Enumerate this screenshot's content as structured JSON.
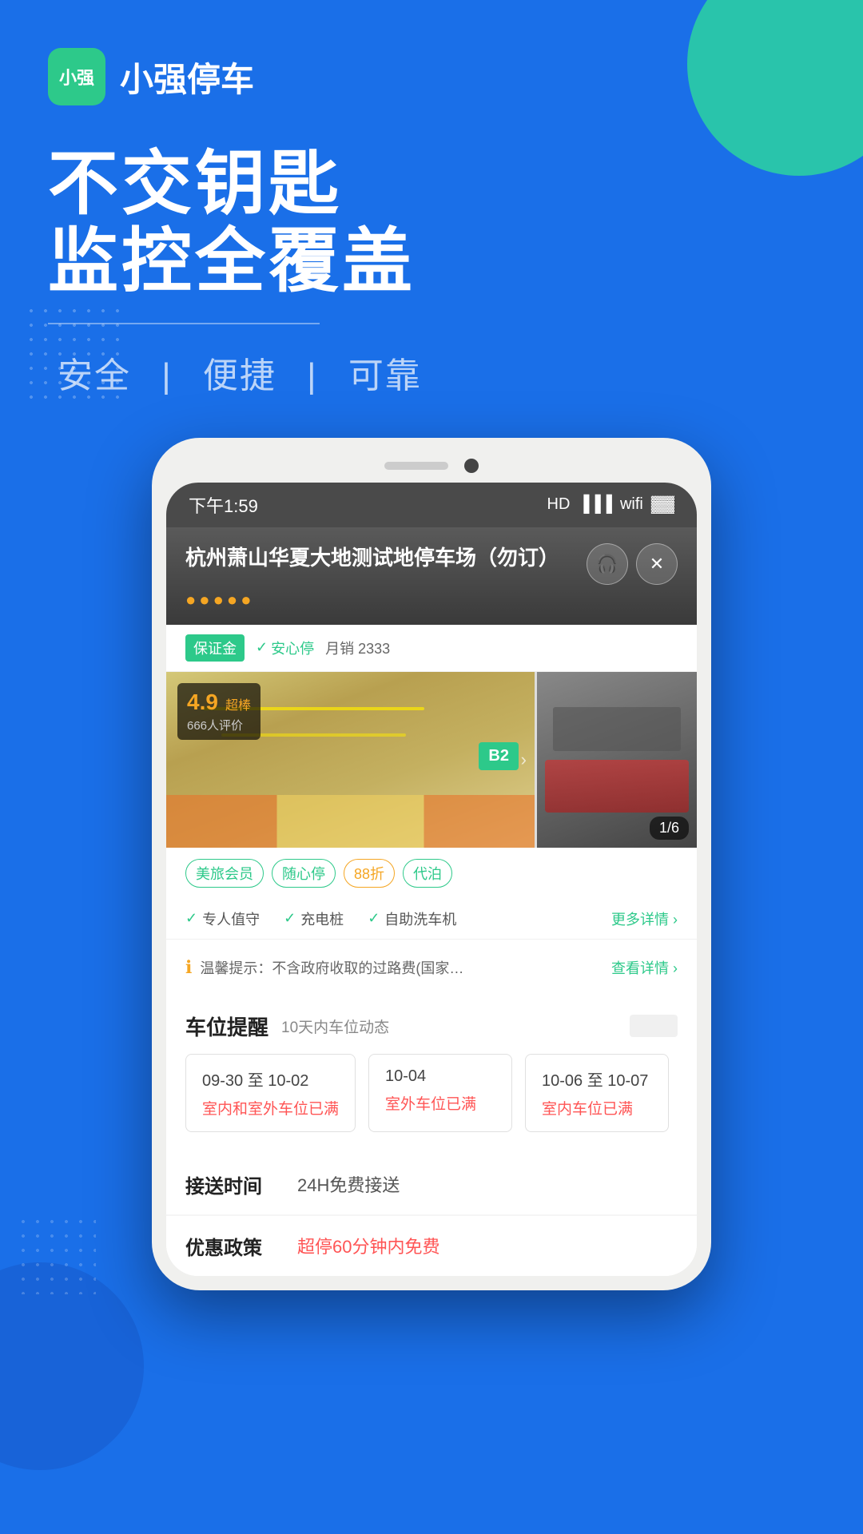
{
  "app": {
    "logo_text": "小强",
    "name": "小强停车"
  },
  "hero": {
    "line1": "不交钥匙",
    "line2": "监控全覆盖",
    "divider": true,
    "subtitle": "安全",
    "subtitle_sep1": "|",
    "subtitle_mid": "便捷",
    "subtitle_sep2": "|",
    "subtitle_end": "可靠"
  },
  "status_bar": {
    "time": "下午1:59",
    "hd": "HD",
    "battery": "▓"
  },
  "parking": {
    "title": "杭州萧山华夏大地测试地停车场（勿订）",
    "stars": [
      "●",
      "●",
      "●",
      "●",
      "●"
    ],
    "badge_guarantee": "保证金",
    "badge_safe": "安心停",
    "monthly_sales": "月销 2333",
    "rating": "4.9",
    "rating_label": "超棒",
    "rating_count": "666人评价",
    "image_counter": "1/6",
    "feature_tags": [
      "美旅会员",
      "随心停",
      "88折",
      "代泊"
    ],
    "amenities": [
      "专人值守",
      "充电桩",
      "自助洗车机"
    ],
    "more_details": "更多详情 ›",
    "notice_text": "温馨提示：不含政府收取的过路费(国家…",
    "notice_link": "查看详情 ›",
    "parking_avail_title": "车位提醒",
    "parking_avail_subtitle": "10天内车位动态",
    "availability": [
      {
        "date": "09-30 至 10-02",
        "status": "室内和室外车位已满"
      },
      {
        "date": "10-04",
        "status": "室外车位已满"
      },
      {
        "date": "10-06 至 10-07",
        "status": "室内车位已满"
      }
    ],
    "transfer_time_label": "接送时间",
    "transfer_time_value": "24H免费接送",
    "discount_label": "优惠政策",
    "discount_value": "超停60分钟内免费"
  }
}
